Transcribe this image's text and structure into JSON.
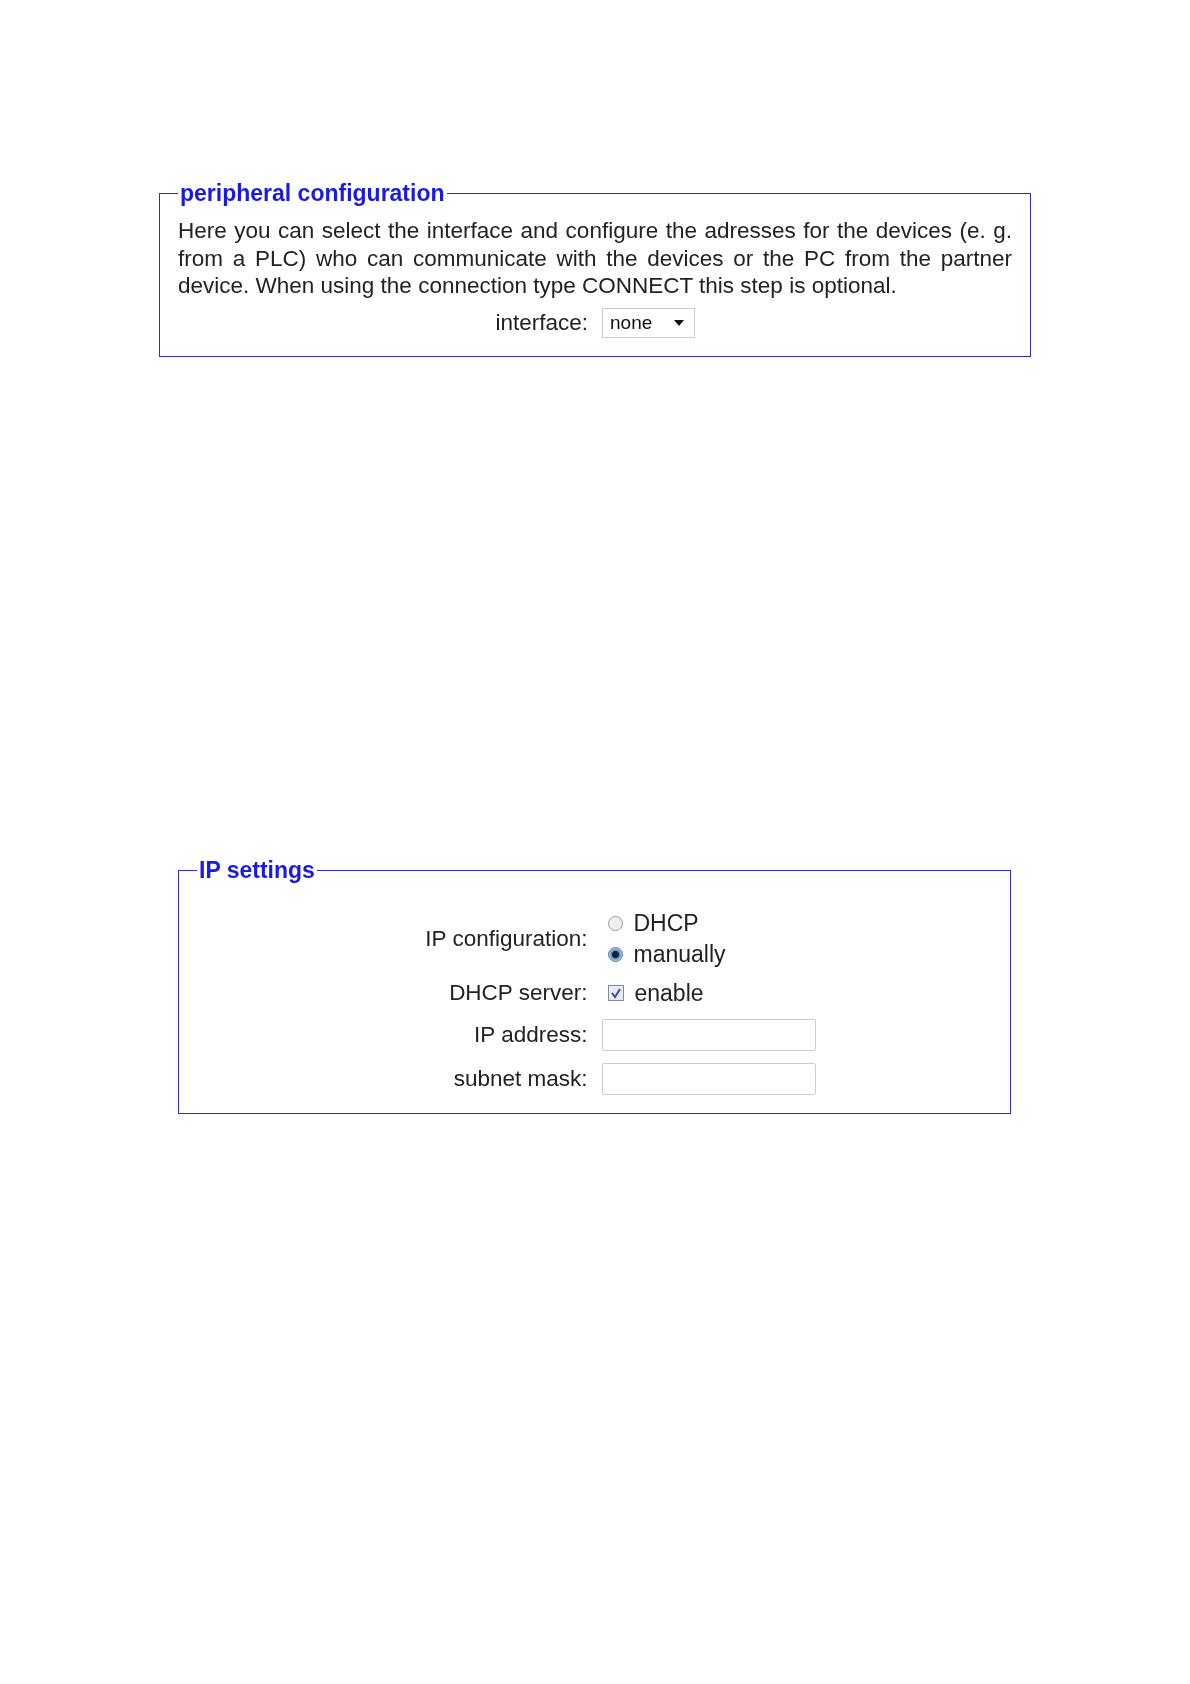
{
  "panels": [
    {
      "legend": "peripheral configuration",
      "text": "Here you can select the interface and configure the adresses for the devices (e. g. from a PLC) who can communicate with the devices or the PC from the partner device. When using the connection type CONNECT this step is optional.",
      "fields": [
        {
          "kind": "select",
          "label": "interface:",
          "value": "none"
        }
      ]
    },
    {
      "legend": "IP settings",
      "fields": [
        {
          "kind": "radio",
          "label": "IP configuration:",
          "options": [
            {
              "label": "DHCP",
              "selected": false
            },
            {
              "label": "manually",
              "selected": true
            }
          ]
        },
        {
          "kind": "checkbox",
          "label": "DHCP server:",
          "option": "enable",
          "checked": true
        },
        {
          "kind": "text",
          "label": "IP address:"
        },
        {
          "kind": "text",
          "label": "subnet mask:"
        }
      ]
    }
  ]
}
